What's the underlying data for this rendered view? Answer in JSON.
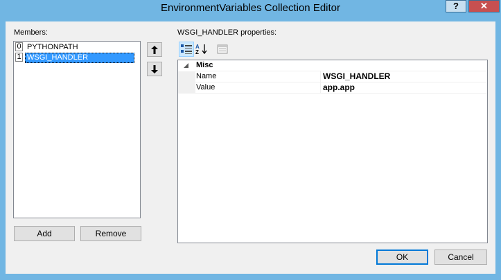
{
  "window": {
    "title": "EnvironmentVariables Collection Editor",
    "help_label": "?",
    "close_label": "✕"
  },
  "members": {
    "label": "Members:",
    "items": [
      {
        "index": "0",
        "name": "PYTHONPATH",
        "selected": false
      },
      {
        "index": "1",
        "name": "WSGI_HANDLER",
        "selected": true
      }
    ],
    "move_up_icon": "arrow-up-icon",
    "move_down_icon": "arrow-down-icon",
    "add_label": "Add",
    "remove_label": "Remove"
  },
  "properties": {
    "label": "WSGI_HANDLER properties:",
    "toolbar": {
      "categorized_icon": "categorized-icon",
      "alphabetical_icon": "alphabetical-icon",
      "property-pages_icon": "property-pages-icon"
    },
    "category": {
      "name": "Misc",
      "expanded": true
    },
    "rows": [
      {
        "name": "Name",
        "value": "WSGI_HANDLER"
      },
      {
        "name": "Value",
        "value": "app.app"
      }
    ]
  },
  "footer": {
    "ok_label": "OK",
    "cancel_label": "Cancel"
  },
  "colors": {
    "titlebar": "#71b6e3",
    "close": "#c75050",
    "selection": "#3399ff"
  }
}
